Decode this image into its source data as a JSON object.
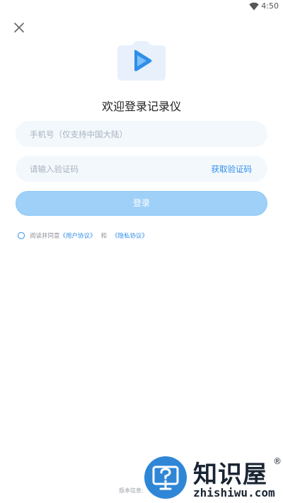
{
  "status_bar": {
    "time": "4:50",
    "wifi_icon": "wifi-icon"
  },
  "header": {
    "close_icon": "close-icon"
  },
  "logo": {
    "icon": "play-logo-icon",
    "colors": {
      "body": "#e8f1fb",
      "play": "#2f8ee8"
    }
  },
  "title": "欢迎登录记录仪",
  "phone": {
    "value": "",
    "placeholder": "手机号（仅支持中国大陆）"
  },
  "code": {
    "value": "",
    "placeholder": "请输入验证码",
    "get_code_label": "获取验证码"
  },
  "login": {
    "label": "登录",
    "color": "#9fd0f8"
  },
  "agreement": {
    "prefix": "阅读并同意",
    "user_agreement": "《用户协议》",
    "conjunction": "和",
    "privacy_policy": "《隐私协议》"
  },
  "footer": {
    "version_label": "版本信息:"
  },
  "watermark": {
    "cn": "知识屋",
    "en": "zhishiwu.com",
    "reg": "®"
  },
  "colors": {
    "accent": "#2f8ee8",
    "field_bg": "#f3f8fd"
  }
}
